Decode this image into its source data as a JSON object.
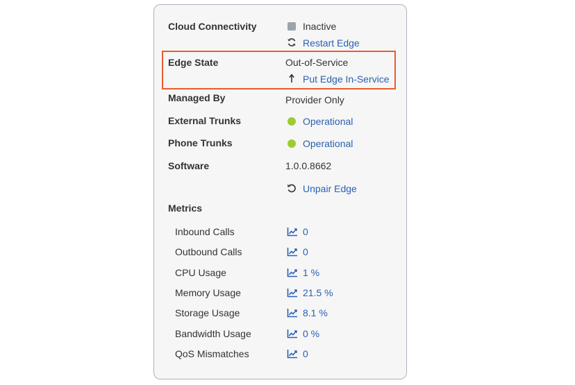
{
  "rows": {
    "cloud_connectivity": {
      "label": "Cloud Connectivity",
      "value": "Inactive",
      "action": "Restart Edge"
    },
    "edge_state": {
      "label": "Edge State",
      "value": "Out-of-Service",
      "action": "Put Edge In-Service"
    },
    "managed_by": {
      "label": "Managed By",
      "value": "Provider Only"
    },
    "external_trunks": {
      "label": "External Trunks",
      "value": "Operational"
    },
    "phone_trunks": {
      "label": "Phone Trunks",
      "value": "Operational"
    },
    "software": {
      "label": "Software",
      "value": "1.0.0.8662",
      "action": "Unpair Edge"
    }
  },
  "metrics": {
    "heading": "Metrics",
    "items": [
      {
        "label": "Inbound Calls",
        "value": "0"
      },
      {
        "label": "Outbound Calls",
        "value": "0"
      },
      {
        "label": "CPU Usage",
        "value": "1 %"
      },
      {
        "label": "Memory Usage",
        "value": "21.5 %"
      },
      {
        "label": "Storage Usage",
        "value": "8.1 %"
      },
      {
        "label": "Bandwidth Usage",
        "value": "0 %"
      },
      {
        "label": "QoS Mismatches",
        "value": "0"
      }
    ]
  },
  "colors": {
    "link": "#2a60b4",
    "status_inactive": "#9aa4ad",
    "status_operational": "#9ccc2e",
    "highlight": "#ea5b2a"
  },
  "icons": {
    "inactive": "square-status-icon",
    "restart": "refresh-icon",
    "put_in_service": "arrow-up-icon",
    "operational": "green-dot-status-icon",
    "unpair": "undo-icon",
    "metric": "line-chart-icon"
  }
}
